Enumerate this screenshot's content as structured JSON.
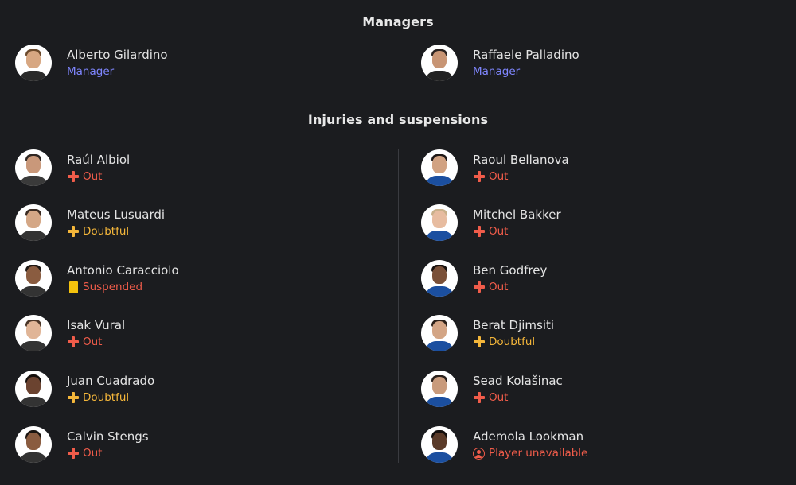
{
  "managers": {
    "title": "Managers",
    "items": [
      {
        "name": "Alberto Gilardino",
        "role": "Manager"
      },
      {
        "name": "Raffaele Palladino",
        "role": "Manager"
      }
    ]
  },
  "injuries": {
    "title": "Injuries and suspensions",
    "left": [
      {
        "name": "Raúl Albiol",
        "status": "Out",
        "icon": "cross-icon"
      },
      {
        "name": "Mateus Lusuardi",
        "status": "Doubtful",
        "icon": "cross-icon"
      },
      {
        "name": "Antonio Caracciolo",
        "status": "Suspended",
        "icon": "yellow-card-icon"
      },
      {
        "name": "Isak Vural",
        "status": "Out",
        "icon": "cross-icon"
      },
      {
        "name": "Juan Cuadrado",
        "status": "Doubtful",
        "icon": "cross-icon"
      },
      {
        "name": "Calvin Stengs",
        "status": "Out",
        "icon": "cross-icon"
      }
    ],
    "right": [
      {
        "name": "Raoul Bellanova",
        "status": "Out",
        "icon": "cross-icon"
      },
      {
        "name": "Mitchel Bakker",
        "status": "Out",
        "icon": "cross-icon"
      },
      {
        "name": "Ben Godfrey",
        "status": "Out",
        "icon": "cross-icon"
      },
      {
        "name": "Berat Djimsiti",
        "status": "Doubtful",
        "icon": "cross-icon"
      },
      {
        "name": "Sead Kolašinac",
        "status": "Out",
        "icon": "cross-icon"
      },
      {
        "name": "Ademola Lookman",
        "status": "Player unavailable",
        "icon": "person-icon"
      }
    ]
  },
  "colors": {
    "background": "#1b1c1f",
    "role": "#7f86ff",
    "out": "#f05c4a",
    "doubtful": "#f4b63a",
    "card": "#f4c20d"
  }
}
